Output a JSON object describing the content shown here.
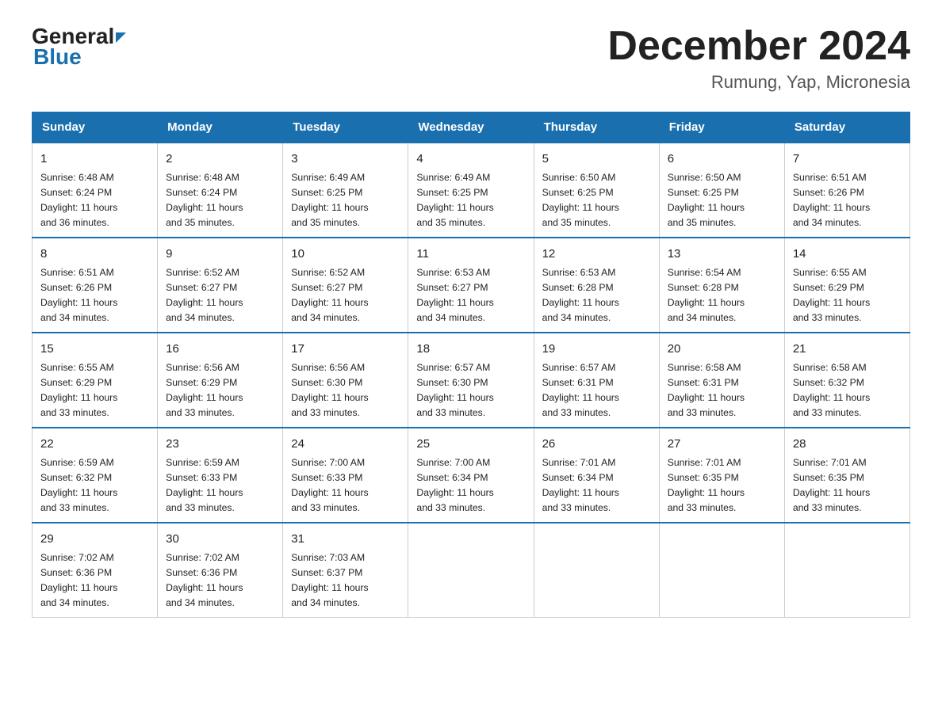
{
  "logo": {
    "general": "General",
    "blue": "Blue"
  },
  "title": "December 2024",
  "location": "Rumung, Yap, Micronesia",
  "headers": [
    "Sunday",
    "Monday",
    "Tuesday",
    "Wednesday",
    "Thursday",
    "Friday",
    "Saturday"
  ],
  "weeks": [
    [
      {
        "day": "1",
        "info": "Sunrise: 6:48 AM\nSunset: 6:24 PM\nDaylight: 11 hours\nand 36 minutes."
      },
      {
        "day": "2",
        "info": "Sunrise: 6:48 AM\nSunset: 6:24 PM\nDaylight: 11 hours\nand 35 minutes."
      },
      {
        "day": "3",
        "info": "Sunrise: 6:49 AM\nSunset: 6:25 PM\nDaylight: 11 hours\nand 35 minutes."
      },
      {
        "day": "4",
        "info": "Sunrise: 6:49 AM\nSunset: 6:25 PM\nDaylight: 11 hours\nand 35 minutes."
      },
      {
        "day": "5",
        "info": "Sunrise: 6:50 AM\nSunset: 6:25 PM\nDaylight: 11 hours\nand 35 minutes."
      },
      {
        "day": "6",
        "info": "Sunrise: 6:50 AM\nSunset: 6:25 PM\nDaylight: 11 hours\nand 35 minutes."
      },
      {
        "day": "7",
        "info": "Sunrise: 6:51 AM\nSunset: 6:26 PM\nDaylight: 11 hours\nand 34 minutes."
      }
    ],
    [
      {
        "day": "8",
        "info": "Sunrise: 6:51 AM\nSunset: 6:26 PM\nDaylight: 11 hours\nand 34 minutes."
      },
      {
        "day": "9",
        "info": "Sunrise: 6:52 AM\nSunset: 6:27 PM\nDaylight: 11 hours\nand 34 minutes."
      },
      {
        "day": "10",
        "info": "Sunrise: 6:52 AM\nSunset: 6:27 PM\nDaylight: 11 hours\nand 34 minutes."
      },
      {
        "day": "11",
        "info": "Sunrise: 6:53 AM\nSunset: 6:27 PM\nDaylight: 11 hours\nand 34 minutes."
      },
      {
        "day": "12",
        "info": "Sunrise: 6:53 AM\nSunset: 6:28 PM\nDaylight: 11 hours\nand 34 minutes."
      },
      {
        "day": "13",
        "info": "Sunrise: 6:54 AM\nSunset: 6:28 PM\nDaylight: 11 hours\nand 34 minutes."
      },
      {
        "day": "14",
        "info": "Sunrise: 6:55 AM\nSunset: 6:29 PM\nDaylight: 11 hours\nand 33 minutes."
      }
    ],
    [
      {
        "day": "15",
        "info": "Sunrise: 6:55 AM\nSunset: 6:29 PM\nDaylight: 11 hours\nand 33 minutes."
      },
      {
        "day": "16",
        "info": "Sunrise: 6:56 AM\nSunset: 6:29 PM\nDaylight: 11 hours\nand 33 minutes."
      },
      {
        "day": "17",
        "info": "Sunrise: 6:56 AM\nSunset: 6:30 PM\nDaylight: 11 hours\nand 33 minutes."
      },
      {
        "day": "18",
        "info": "Sunrise: 6:57 AM\nSunset: 6:30 PM\nDaylight: 11 hours\nand 33 minutes."
      },
      {
        "day": "19",
        "info": "Sunrise: 6:57 AM\nSunset: 6:31 PM\nDaylight: 11 hours\nand 33 minutes."
      },
      {
        "day": "20",
        "info": "Sunrise: 6:58 AM\nSunset: 6:31 PM\nDaylight: 11 hours\nand 33 minutes."
      },
      {
        "day": "21",
        "info": "Sunrise: 6:58 AM\nSunset: 6:32 PM\nDaylight: 11 hours\nand 33 minutes."
      }
    ],
    [
      {
        "day": "22",
        "info": "Sunrise: 6:59 AM\nSunset: 6:32 PM\nDaylight: 11 hours\nand 33 minutes."
      },
      {
        "day": "23",
        "info": "Sunrise: 6:59 AM\nSunset: 6:33 PM\nDaylight: 11 hours\nand 33 minutes."
      },
      {
        "day": "24",
        "info": "Sunrise: 7:00 AM\nSunset: 6:33 PM\nDaylight: 11 hours\nand 33 minutes."
      },
      {
        "day": "25",
        "info": "Sunrise: 7:00 AM\nSunset: 6:34 PM\nDaylight: 11 hours\nand 33 minutes."
      },
      {
        "day": "26",
        "info": "Sunrise: 7:01 AM\nSunset: 6:34 PM\nDaylight: 11 hours\nand 33 minutes."
      },
      {
        "day": "27",
        "info": "Sunrise: 7:01 AM\nSunset: 6:35 PM\nDaylight: 11 hours\nand 33 minutes."
      },
      {
        "day": "28",
        "info": "Sunrise: 7:01 AM\nSunset: 6:35 PM\nDaylight: 11 hours\nand 33 minutes."
      }
    ],
    [
      {
        "day": "29",
        "info": "Sunrise: 7:02 AM\nSunset: 6:36 PM\nDaylight: 11 hours\nand 34 minutes."
      },
      {
        "day": "30",
        "info": "Sunrise: 7:02 AM\nSunset: 6:36 PM\nDaylight: 11 hours\nand 34 minutes."
      },
      {
        "day": "31",
        "info": "Sunrise: 7:03 AM\nSunset: 6:37 PM\nDaylight: 11 hours\nand 34 minutes."
      },
      {
        "day": "",
        "info": ""
      },
      {
        "day": "",
        "info": ""
      },
      {
        "day": "",
        "info": ""
      },
      {
        "day": "",
        "info": ""
      }
    ]
  ]
}
